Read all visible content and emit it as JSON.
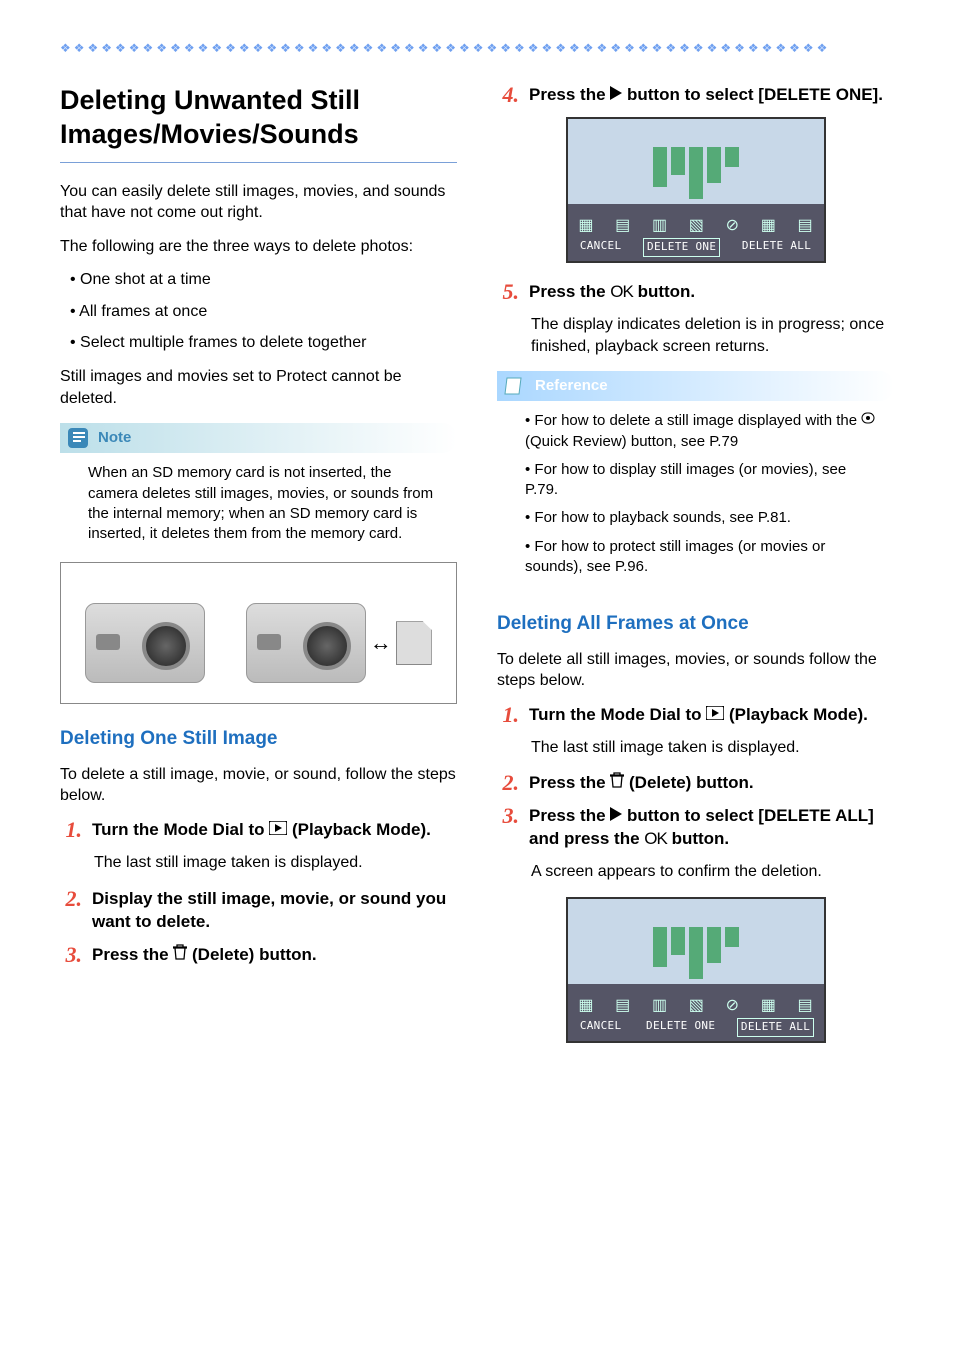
{
  "decoration_row": "❖❖❖❖❖❖❖❖❖❖❖❖❖❖❖❖❖❖❖❖❖❖❖❖❖❖❖❖❖❖❖❖❖❖❖❖❖❖❖❖❖❖❖❖❖❖❖❖❖❖❖❖❖❖❖❖",
  "title": "Deleting Unwanted Still Images/Movies/Sounds",
  "intro_p1": "You can easily delete still images, movies, and sounds that have not come out right.",
  "intro_p2": "The following are the three ways to delete photos:",
  "intro_bullets": [
    "One shot at a time",
    "All frames at once",
    "Select multiple frames to delete together"
  ],
  "intro_p3": "Still images and movies set to Protect cannot be deleted.",
  "note": {
    "label": "Note",
    "body": "When an SD memory card is not inserted, the camera deletes still images, movies, or sounds from the internal memory; when an SD memory card is inserted, it deletes them from the memory card."
  },
  "section_one": {
    "heading": "Deleting One Still Image",
    "intro": "To delete a still image, movie, or sound, follow the steps below.",
    "steps": [
      {
        "num": "1.",
        "pre": "Turn the Mode Dial to ",
        "post": " (Playback Mode).",
        "desc": "The last still image taken is displayed."
      },
      {
        "num": "2.",
        "text": "Display the still image, movie, or sound you want to delete."
      },
      {
        "num": "3.",
        "pre": "Press the ",
        "post": "(Delete) button."
      }
    ]
  },
  "section_one_cont": {
    "step4": {
      "num": "4.",
      "pre": "Press the ",
      "post": " button to select [DELETE ONE]."
    },
    "step5": {
      "num": "5.",
      "pre": "Press the ",
      "mid": "O",
      "post": " button.",
      "desc": "The display indicates deletion is in progress; once finished, playback screen returns."
    }
  },
  "screenshot": {
    "cancel": "CANCEL",
    "one": "DELETE ONE",
    "all": "DELETE ALL"
  },
  "reference": {
    "label": "Reference",
    "items": [
      {
        "pre": "For how to delete a still image displayed with the ",
        "post": " (Quick Review) button, see P.79"
      },
      {
        "text": "For how to display still images (or movies), see P.79."
      },
      {
        "text": "For how to playback sounds, see P.81."
      },
      {
        "text": "For how to protect still images (or movies or sounds), see P.96."
      }
    ]
  },
  "section_two": {
    "heading": "Deleting All Frames at Once",
    "intro": "To delete all still images, movies, or sounds follow the steps below.",
    "steps": [
      {
        "num": "1.",
        "pre": "Turn the Mode Dial to ",
        "post": " (Playback Mode).",
        "desc": "The last still image taken is displayed."
      },
      {
        "num": "2.",
        "pre": "Press the ",
        "post": " (Delete) button."
      },
      {
        "num": "3.",
        "pre": "Press the ",
        "mid": " button to select [DELETE ALL] and press the ",
        "post": " button.",
        "desc": "A screen appears to confirm the deletion."
      }
    ]
  },
  "icons": {
    "playback": "▶",
    "trash": "🗑",
    "right": "▶",
    "ok": "OK",
    "quick": "⦿"
  }
}
